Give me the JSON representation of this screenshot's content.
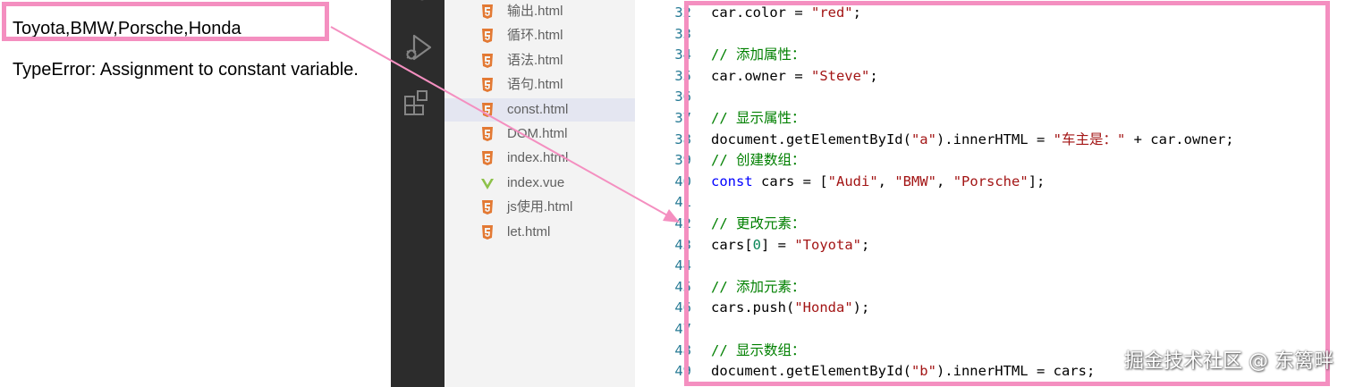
{
  "output": {
    "line1": "Toyota,BMW,Porsche,Honda",
    "line2": "TypeError: Assignment to constant variable."
  },
  "activity_bar": {
    "icons": [
      "search-icon",
      "run-debug-icon",
      "extensions-icon"
    ]
  },
  "explorer": {
    "files": [
      {
        "name": "输出.html",
        "icon": "html5-icon",
        "active": false
      },
      {
        "name": "循环.html",
        "icon": "html5-icon",
        "active": false
      },
      {
        "name": "语法.html",
        "icon": "html5-icon",
        "active": false
      },
      {
        "name": "语句.html",
        "icon": "html5-icon",
        "active": false
      },
      {
        "name": "const.html",
        "icon": "html5-icon",
        "active": true
      },
      {
        "name": "DOM.html",
        "icon": "html5-icon",
        "active": false
      },
      {
        "name": "index.html",
        "icon": "html5-icon",
        "active": false
      },
      {
        "name": "index.vue",
        "icon": "vue-icon",
        "active": false
      },
      {
        "name": "js使用.html",
        "icon": "html5-icon",
        "active": false
      },
      {
        "name": "let.html",
        "icon": "html5-icon",
        "active": false
      }
    ]
  },
  "editor": {
    "lines": [
      {
        "num": "32",
        "tokens": [
          [
            "plain",
            "car.color = "
          ],
          [
            "str",
            "\"red\""
          ],
          [
            "plain",
            ";"
          ]
        ]
      },
      {
        "num": "33",
        "tokens": []
      },
      {
        "num": "34",
        "tokens": [
          [
            "com",
            "// 添加属性："
          ]
        ]
      },
      {
        "num": "35",
        "tokens": [
          [
            "plain",
            "car.owner = "
          ],
          [
            "str",
            "\"Steve\""
          ],
          [
            "plain",
            ";"
          ]
        ]
      },
      {
        "num": "36",
        "tokens": []
      },
      {
        "num": "37",
        "tokens": [
          [
            "com",
            "// 显示属性："
          ]
        ]
      },
      {
        "num": "38",
        "tokens": [
          [
            "plain",
            "document.getElementById("
          ],
          [
            "str",
            "\"a\""
          ],
          [
            "plain",
            ").innerHTML = "
          ],
          [
            "str",
            "\"车主是：\""
          ],
          [
            "plain",
            " + car.owner;"
          ]
        ]
      },
      {
        "num": "39",
        "tokens": [
          [
            "com",
            "// 创建数组："
          ]
        ]
      },
      {
        "num": "40",
        "tokens": [
          [
            "kw",
            "const"
          ],
          [
            "plain",
            " cars = ["
          ],
          [
            "str",
            "\"Audi\""
          ],
          [
            "plain",
            ", "
          ],
          [
            "str",
            "\"BMW\""
          ],
          [
            "plain",
            ", "
          ],
          [
            "str",
            "\"Porsche\""
          ],
          [
            "plain",
            "];"
          ]
        ]
      },
      {
        "num": "41",
        "tokens": []
      },
      {
        "num": "42",
        "tokens": [
          [
            "com",
            "// 更改元素："
          ]
        ]
      },
      {
        "num": "43",
        "tokens": [
          [
            "plain",
            "cars["
          ],
          [
            "num",
            "0"
          ],
          [
            "plain",
            "] = "
          ],
          [
            "str",
            "\"Toyota\""
          ],
          [
            "plain",
            ";"
          ]
        ]
      },
      {
        "num": "44",
        "tokens": []
      },
      {
        "num": "45",
        "tokens": [
          [
            "com",
            "// 添加元素："
          ]
        ]
      },
      {
        "num": "46",
        "tokens": [
          [
            "plain",
            "cars.push("
          ],
          [
            "str",
            "\"Honda\""
          ],
          [
            "plain",
            ");"
          ]
        ]
      },
      {
        "num": "47",
        "tokens": []
      },
      {
        "num": "48",
        "tokens": [
          [
            "com",
            "// 显示数组："
          ]
        ]
      },
      {
        "num": "49",
        "tokens": [
          [
            "plain",
            "document.getElementById("
          ],
          [
            "str",
            "\"b\""
          ],
          [
            "plain",
            ").innerHTML = cars;"
          ]
        ]
      }
    ]
  },
  "watermark": "掘金技术社区 @ 东篱畔",
  "colors": {
    "highlight": "#f48fc0",
    "string": "#a31515",
    "comment": "#008000",
    "keyword": "#0000ff",
    "number": "#098658",
    "line_number": "#237893",
    "html5_icon": "#e37933",
    "vue_icon": "#8dc149"
  }
}
